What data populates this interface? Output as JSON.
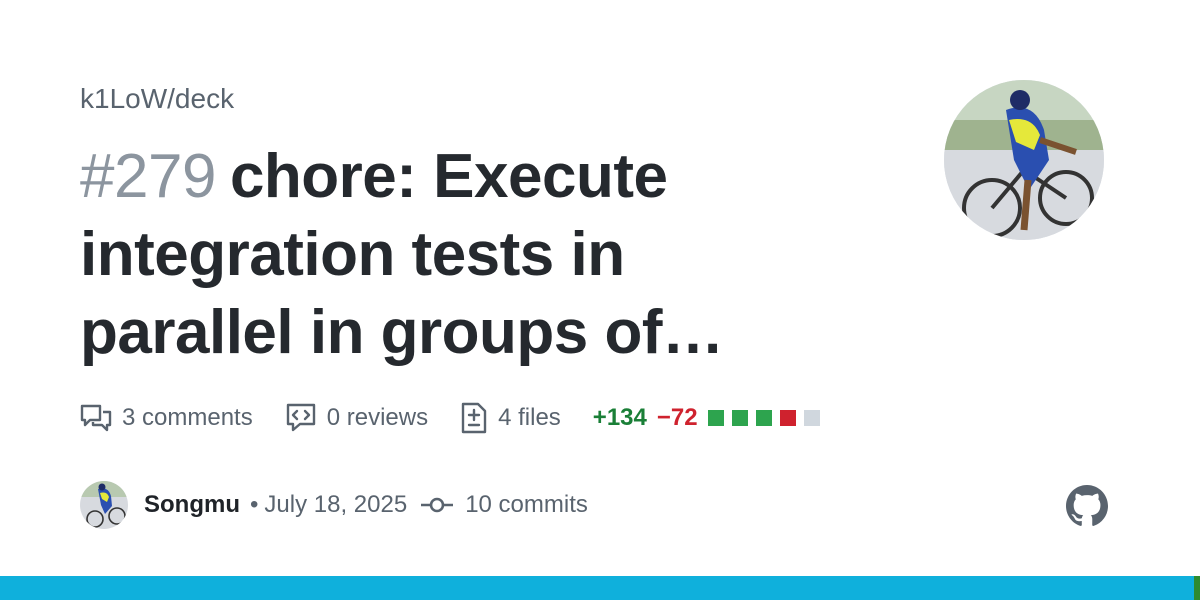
{
  "repo": "k1LoW/deck",
  "pr": {
    "number": "#279",
    "title": "chore: Execute integration tests in parallel in groups of…"
  },
  "stats": {
    "comments": "3 comments",
    "reviews": "0 reviews",
    "files": "4 files",
    "additions": "+134",
    "deletions": "−72",
    "diffstat": [
      {
        "kind": "added",
        "color": "#2da44e"
      },
      {
        "kind": "added",
        "color": "#2da44e"
      },
      {
        "kind": "added",
        "color": "#2da44e"
      },
      {
        "kind": "deleted",
        "color": "#cf222e"
      },
      {
        "kind": "neutral",
        "color": "#d0d7de"
      }
    ]
  },
  "author": {
    "name": "Songmu",
    "date": "July 18, 2025",
    "commits": "10 commits"
  },
  "colors": {
    "bar_main": "#0fb0dc",
    "bar_end": "#2e8b2e"
  }
}
